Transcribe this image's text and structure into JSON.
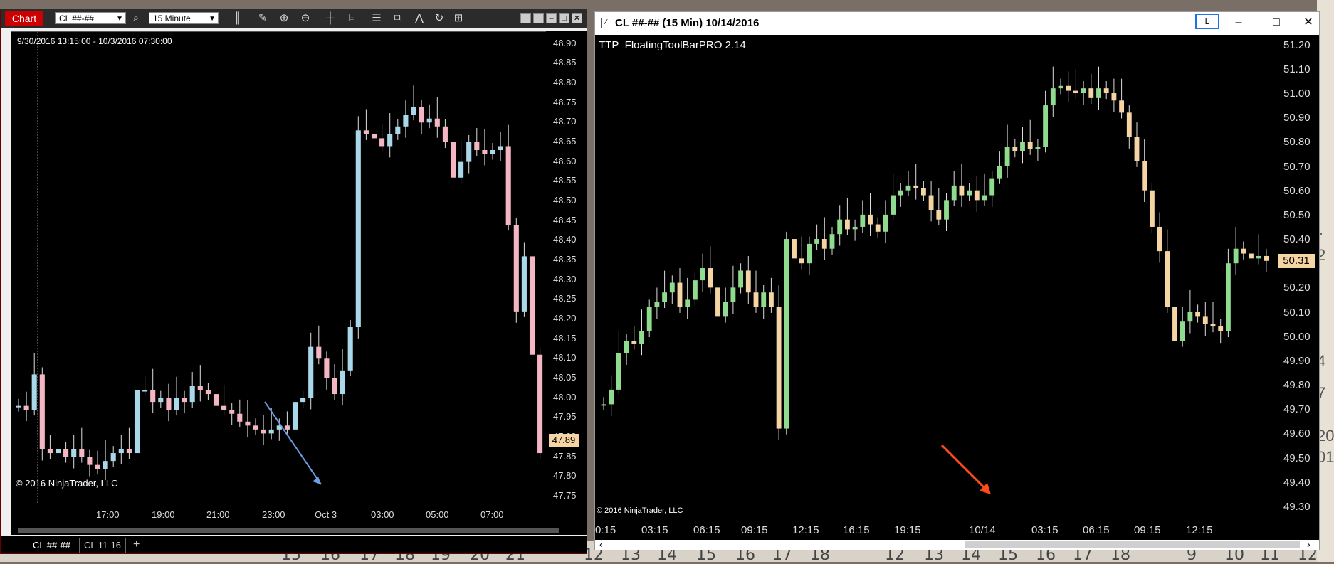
{
  "background": {
    "bottom_numbers": [
      "15",
      "16",
      "17",
      "18",
      "19",
      "20",
      "21",
      "12",
      "13",
      "14",
      "15",
      "16",
      "17",
      "18",
      "12",
      "13",
      "14",
      "15",
      "16",
      "17",
      "18",
      "9",
      "10",
      "11",
      "12"
    ],
    "right_fragments": [
      "r 2",
      "20",
      "01",
      "4",
      "7"
    ]
  },
  "left_window": {
    "tab_label": "Chart",
    "instrument": "CL ##-##",
    "interval": "15 Minute",
    "toolbar_icons": [
      "search-icon",
      "bar-style-icon",
      "pencil-icon",
      "zoom-in-icon",
      "zoom-out-icon",
      "crosshair-icon",
      "data-box-icon",
      "properties-icon",
      "strategies-icon",
      "indicators-icon",
      "refresh-icon",
      "templates-icon"
    ],
    "date_range": "9/30/2016 13:15:00 - 10/3/2016 07:30:00",
    "copyright": "© 2016 NinjaTrader, LLC",
    "last_price": "47.89",
    "colors": {
      "up": "#a8d8ea",
      "down": "#f4b6c2",
      "price_tag": "#f6d5a5",
      "arrow": "#6f9fe0"
    },
    "y_labels": [
      "48.90",
      "48.85",
      "48.80",
      "48.75",
      "48.70",
      "48.65",
      "48.60",
      "48.55",
      "48.50",
      "48.45",
      "48.40",
      "48.35",
      "48.30",
      "48.25",
      "48.20",
      "48.15",
      "48.10",
      "48.05",
      "48.00",
      "47.95",
      "47.90",
      "47.85",
      "47.80",
      "47.75"
    ],
    "x_labels": [
      "17:00",
      "19:00",
      "21:00",
      "23:00",
      "Oct 3",
      "03:00",
      "05:00",
      "07:00"
    ],
    "tabs": [
      "CL ##-##",
      "CL 11-16",
      "+"
    ]
  },
  "right_window": {
    "title": "CL ##-## (15 Min)  10/14/2016",
    "indicator": "TTP_FloatingToolBarPRO 2.14",
    "corner_button": "L",
    "copyright": "© 2016 NinjaTrader, LLC",
    "last_price": "50.31",
    "colors": {
      "up": "#8fdc8f",
      "down": "#f6d5a5",
      "price_tag": "#f6d5a5",
      "arrow": "#ff4a1c"
    },
    "y_labels": [
      "51.20",
      "51.10",
      "51.00",
      "50.90",
      "50.80",
      "50.70",
      "50.60",
      "50.50",
      "50.40",
      "50.30",
      "50.20",
      "50.10",
      "50.00",
      "49.90",
      "49.80",
      "49.70",
      "49.60",
      "49.50",
      "49.40",
      "49.30"
    ],
    "x_labels": [
      "0:15",
      "03:15",
      "06:15",
      "09:15",
      "12:15",
      "16:15",
      "19:15",
      "10/14",
      "03:15",
      "06:15",
      "09:15",
      "12:15"
    ]
  },
  "chart_data": [
    {
      "type": "candlestick",
      "instrument": "CL ##-##",
      "interval": "15 Minute",
      "ylim": [
        47.73,
        48.93
      ],
      "close": [
        47.98,
        47.97,
        48.06,
        47.87,
        47.86,
        47.87,
        47.85,
        47.87,
        47.85,
        47.83,
        47.82,
        47.84,
        47.86,
        47.87,
        47.86,
        48.02,
        48.02,
        47.99,
        48.0,
        47.97,
        48.0,
        47.99,
        48.03,
        48.02,
        48.01,
        47.98,
        47.97,
        47.96,
        47.94,
        47.93,
        47.92,
        47.91,
        47.92,
        47.93,
        47.92,
        47.99,
        48.0,
        48.13,
        48.1,
        48.05,
        48.01,
        48.07,
        48.18,
        48.68,
        48.67,
        48.66,
        48.64,
        48.67,
        48.69,
        48.72,
        48.74,
        48.7,
        48.71,
        48.69,
        48.65,
        48.56,
        48.6,
        48.65,
        48.63,
        48.62,
        48.63,
        48.64,
        48.44,
        48.22,
        48.36,
        48.11,
        47.86
      ]
    },
    {
      "type": "candlestick",
      "instrument": "CL ##-##",
      "interval": "15 Min",
      "ylim": [
        49.25,
        51.24
      ],
      "close": [
        49.72,
        49.78,
        49.93,
        49.98,
        49.97,
        50.02,
        50.12,
        50.14,
        50.18,
        50.22,
        50.12,
        50.15,
        50.23,
        50.28,
        50.2,
        50.08,
        50.14,
        50.2,
        50.27,
        50.18,
        50.12,
        50.18,
        50.12,
        49.62,
        50.4,
        50.32,
        50.3,
        50.38,
        50.4,
        50.36,
        50.42,
        50.48,
        50.44,
        50.45,
        50.5,
        50.46,
        50.43,
        50.5,
        50.58,
        50.6,
        50.62,
        50.61,
        50.58,
        50.52,
        50.48,
        50.56,
        50.62,
        50.58,
        50.6,
        50.56,
        50.58,
        50.65,
        50.7,
        50.78,
        50.76,
        50.8,
        50.77,
        50.78,
        50.95,
        51.02,
        51.03,
        51.01,
        51.0,
        51.02,
        50.98,
        51.02,
        51.0,
        50.97,
        50.92,
        50.82,
        50.72,
        50.6,
        50.45,
        50.35,
        50.12,
        49.98,
        50.06,
        50.1,
        50.08,
        50.05,
        50.04,
        50.02,
        50.3,
        50.36,
        50.34,
        50.32,
        50.33,
        50.31
      ]
    }
  ]
}
